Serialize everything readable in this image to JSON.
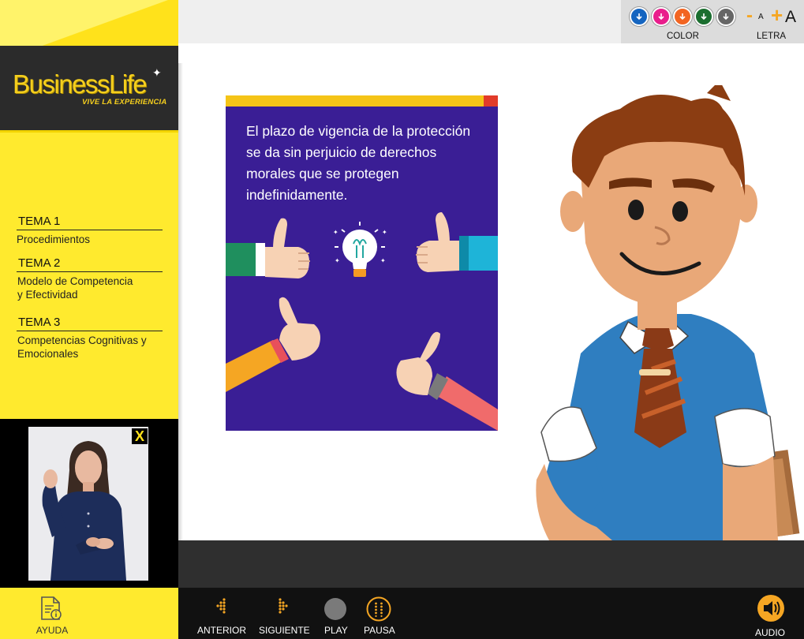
{
  "brand": {
    "name_part1": "Business",
    "name_part2": "Life",
    "tagline": "VIVE LA EXPERIENCIA"
  },
  "toolbar": {
    "colors": [
      {
        "name": "blue",
        "hex": "#1565c0"
      },
      {
        "name": "magenta",
        "hex": "#e91e8c"
      },
      {
        "name": "orange",
        "hex": "#f26522"
      },
      {
        "name": "green",
        "hex": "#1b6e2f"
      },
      {
        "name": "gray",
        "hex": "#666666"
      }
    ],
    "color_label": "COLOR",
    "letra_label": "LETRA",
    "font_decrease_sign": "-",
    "font_decrease_letter": "A",
    "font_increase_sign": "+",
    "font_increase_letter": "A"
  },
  "sidebar": {
    "temas": [
      {
        "title": "TEMA 1",
        "desc_lines": [
          "Procedimientos"
        ]
      },
      {
        "title": "TEMA 2",
        "desc_lines": [
          "Modelo de Competencia",
          "y Efectividad"
        ]
      },
      {
        "title": "TEMA 3",
        "desc_lines": [
          "Competencias Cognitivas y",
          "Emocionales"
        ]
      }
    ],
    "video_close": "X",
    "help_label": "AYUDA"
  },
  "main": {
    "card_text": "El plazo  de vigencia  de la protección se da sin perjuicio de derechos morales que se protegen indefinidamente."
  },
  "controls": {
    "anterior": "ANTERIOR",
    "siguiente": "SIGUIENTE",
    "play": "PLAY",
    "pausa": "PAUSA",
    "audio": "AUDIO"
  },
  "accent": "#f5a623",
  "sidebar_yellow": "#ffea2e",
  "card_purple": "#3a1e95"
}
